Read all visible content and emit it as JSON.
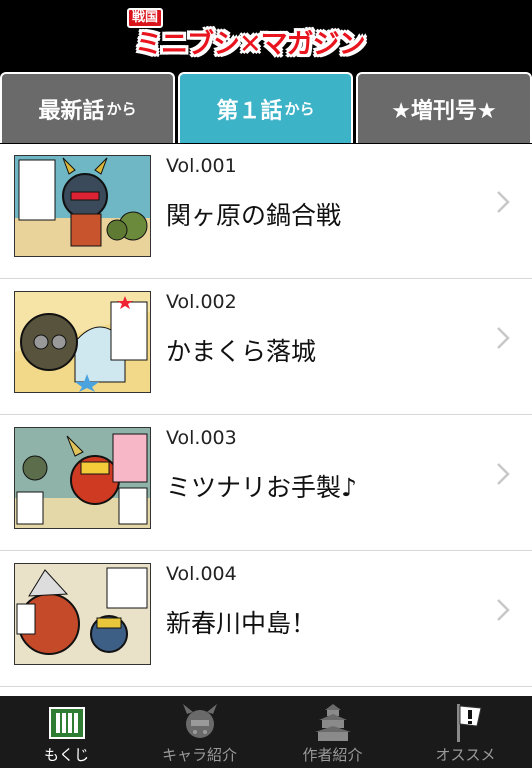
{
  "header": {
    "logo_small": "戦国",
    "logo_main": "ミニブシ✕マガジン"
  },
  "tabs": [
    {
      "main": "最新話",
      "suffix": "から",
      "active": false
    },
    {
      "main": "第１話",
      "suffix": "から",
      "active": true
    },
    {
      "main": "★増刊号★",
      "suffix": "",
      "active": false
    }
  ],
  "episodes": [
    {
      "vol": "Vol.001",
      "title": "関ヶ原の鍋合戦"
    },
    {
      "vol": "Vol.002",
      "title": "かまくら落城"
    },
    {
      "vol": "Vol.003",
      "title": "ミツナリお手製♪"
    },
    {
      "vol": "Vol.004",
      "title": "新春川中島！"
    }
  ],
  "bottom_nav": [
    {
      "label": "もくじ",
      "icon": "book-list-icon",
      "active": true
    },
    {
      "label": "キャラ紹介",
      "icon": "character-icon",
      "active": false
    },
    {
      "label": "作者紹介",
      "icon": "castle-icon",
      "active": false
    },
    {
      "label": "オススメ",
      "icon": "recommend-flag-icon",
      "active": false
    }
  ],
  "colors": {
    "header_bg": "#000000",
    "tab_active": "#3db3c8",
    "tab_inactive": "#6a6a6a",
    "logo_red": "#e8141e",
    "nav_bg": "#1a1a1a",
    "nav_active_icon": "#2e7d32"
  }
}
